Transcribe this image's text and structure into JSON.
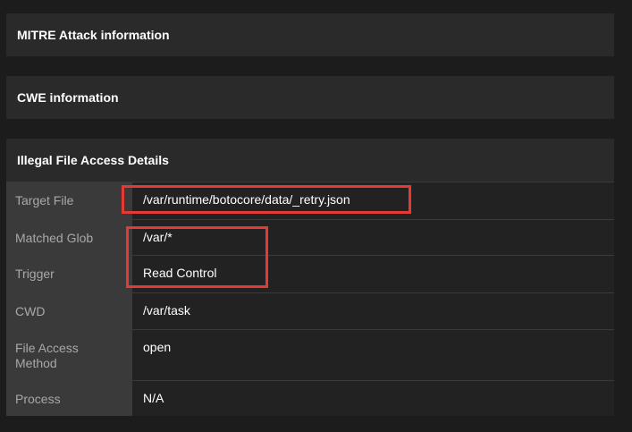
{
  "panels": {
    "mitre": {
      "title": "MITRE Attack information"
    },
    "cwe": {
      "title": "CWE information"
    },
    "illegal": {
      "title": "Illegal File Access Details",
      "rows": [
        {
          "label": "Target File",
          "value": "/var/runtime/botocore/data/_retry.json"
        },
        {
          "label": "Matched Glob",
          "value": "/var/*"
        },
        {
          "label": "Trigger",
          "value": "Read Control"
        },
        {
          "label": "CWD",
          "value": "/var/task"
        },
        {
          "label": "File Access Method",
          "value": "open"
        },
        {
          "label": "Process",
          "value": "N/A"
        }
      ]
    }
  },
  "colors": {
    "background": "#1c1c1c",
    "panel": "#2a2a2a",
    "label_cell": "#3a3a3a",
    "highlight": "#e53935"
  }
}
